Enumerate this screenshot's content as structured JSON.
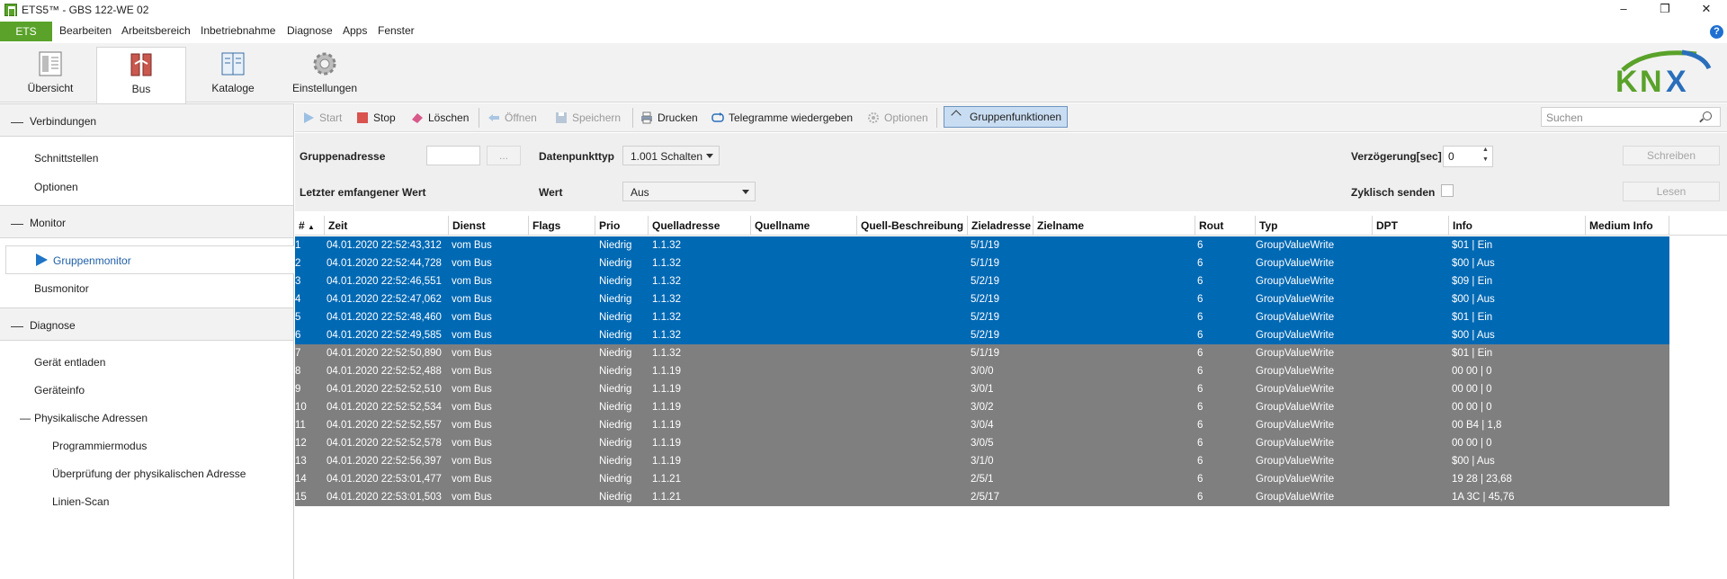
{
  "window": {
    "title": "ETS5™ - GBS 122-WE 02"
  },
  "menu": {
    "ets_label": "ETS",
    "items": [
      "Bearbeiten",
      "Arbeitsbereich",
      "Inbetriebnahme",
      "Diagnose",
      "Apps",
      "Fenster"
    ]
  },
  "ribbon": {
    "tabs": [
      "Übersicht",
      "Bus",
      "Kataloge",
      "Einstellungen"
    ]
  },
  "logo": {
    "text": "KNX"
  },
  "sidebar": {
    "sections": [
      {
        "label": "Verbindungen",
        "items": [
          "Schnittstellen",
          "Optionen"
        ]
      },
      {
        "label": "Monitor",
        "items": [
          "Gruppenmonitor",
          "Busmonitor"
        ]
      },
      {
        "label": "Diagnose",
        "items": [
          "Gerät entladen",
          "Geräteinfo",
          "Physikalische Adressen",
          "Programmiermodus",
          "Überprüfung der physikalischen Adresse",
          "Linien-Scan"
        ]
      }
    ]
  },
  "toolbar": {
    "start": "Start",
    "stop": "Stop",
    "loeschen": "Löschen",
    "oeffnen": "Öffnen",
    "speichern": "Speichern",
    "drucken": "Drucken",
    "telegramme": "Telegramme wiedergeben",
    "optionen": "Optionen",
    "gruppenfunktionen": "Gruppenfunktionen",
    "search_placeholder": "Suchen"
  },
  "filter": {
    "gruppenadresse_label": "Gruppenadresse",
    "gruppenadresse_btn": "...",
    "datenpunkttyp_label": "Datenpunkttyp",
    "datenpunkttyp_value": "1.001 Schalten",
    "letzter_label": "Letzter emfangener Wert",
    "wert_label": "Wert",
    "wert_value": "Aus",
    "verzoegerung_label": "Verzögerung[sec]",
    "verzoegerung_value": "0",
    "zyklisch_label": "Zyklisch senden",
    "schreiben": "Schreiben",
    "lesen": "Lesen"
  },
  "table": {
    "columns": [
      "#",
      "Zeit",
      "Dienst",
      "Flags",
      "Prio",
      "Quelladresse",
      "Quellname",
      "Quell-Beschreibung",
      "Zieladresse",
      "Zielname",
      "Rout",
      "Typ",
      "DPT",
      "Info",
      "Medium Info"
    ],
    "rows": [
      {
        "n": "1",
        "zeit": "04.01.2020 22:52:43,312",
        "dienst": "vom Bus",
        "prio": "Niedrig",
        "quelle": "1.1.32",
        "ziel": "5/1/19",
        "rout": "6",
        "typ": "GroupValueWrite",
        "info": "$01 | Ein",
        "selected": true
      },
      {
        "n": "2",
        "zeit": "04.01.2020 22:52:44,728",
        "dienst": "vom Bus",
        "prio": "Niedrig",
        "quelle": "1.1.32",
        "ziel": "5/1/19",
        "rout": "6",
        "typ": "GroupValueWrite",
        "info": "$00 | Aus",
        "selected": true
      },
      {
        "n": "3",
        "zeit": "04.01.2020 22:52:46,551",
        "dienst": "vom Bus",
        "prio": "Niedrig",
        "quelle": "1.1.32",
        "ziel": "5/2/19",
        "rout": "6",
        "typ": "GroupValueWrite",
        "info": "$09 | Ein",
        "selected": true
      },
      {
        "n": "4",
        "zeit": "04.01.2020 22:52:47,062",
        "dienst": "vom Bus",
        "prio": "Niedrig",
        "quelle": "1.1.32",
        "ziel": "5/2/19",
        "rout": "6",
        "typ": "GroupValueWrite",
        "info": "$00 | Aus",
        "selected": true
      },
      {
        "n": "5",
        "zeit": "04.01.2020 22:52:48,460",
        "dienst": "vom Bus",
        "prio": "Niedrig",
        "quelle": "1.1.32",
        "ziel": "5/2/19",
        "rout": "6",
        "typ": "GroupValueWrite",
        "info": "$01 | Ein",
        "selected": true
      },
      {
        "n": "6",
        "zeit": "04.01.2020 22:52:49,585",
        "dienst": "vom Bus",
        "prio": "Niedrig",
        "quelle": "1.1.32",
        "ziel": "5/2/19",
        "rout": "6",
        "typ": "GroupValueWrite",
        "info": "$00 | Aus",
        "selected": true
      },
      {
        "n": "7",
        "zeit": "04.01.2020 22:52:50,890",
        "dienst": "vom Bus",
        "prio": "Niedrig",
        "quelle": "1.1.32",
        "ziel": "5/1/19",
        "rout": "6",
        "typ": "GroupValueWrite",
        "info": "$01 | Ein",
        "selected": false
      },
      {
        "n": "8",
        "zeit": "04.01.2020 22:52:52,488",
        "dienst": "vom Bus",
        "prio": "Niedrig",
        "quelle": "1.1.19",
        "ziel": "3/0/0",
        "rout": "6",
        "typ": "GroupValueWrite",
        "info": "00 00 | 0",
        "selected": false
      },
      {
        "n": "9",
        "zeit": "04.01.2020 22:52:52,510",
        "dienst": "vom Bus",
        "prio": "Niedrig",
        "quelle": "1.1.19",
        "ziel": "3/0/1",
        "rout": "6",
        "typ": "GroupValueWrite",
        "info": "00 00 | 0",
        "selected": false
      },
      {
        "n": "10",
        "zeit": "04.01.2020 22:52:52,534",
        "dienst": "vom Bus",
        "prio": "Niedrig",
        "quelle": "1.1.19",
        "ziel": "3/0/2",
        "rout": "6",
        "typ": "GroupValueWrite",
        "info": "00 00 | 0",
        "selected": false
      },
      {
        "n": "11",
        "zeit": "04.01.2020 22:52:52,557",
        "dienst": "vom Bus",
        "prio": "Niedrig",
        "quelle": "1.1.19",
        "ziel": "3/0/4",
        "rout": "6",
        "typ": "GroupValueWrite",
        "info": "00 B4 | 1,8",
        "selected": false
      },
      {
        "n": "12",
        "zeit": "04.01.2020 22:52:52,578",
        "dienst": "vom Bus",
        "prio": "Niedrig",
        "quelle": "1.1.19",
        "ziel": "3/0/5",
        "rout": "6",
        "typ": "GroupValueWrite",
        "info": "00 00 | 0",
        "selected": false
      },
      {
        "n": "13",
        "zeit": "04.01.2020 22:52:56,397",
        "dienst": "vom Bus",
        "prio": "Niedrig",
        "quelle": "1.1.19",
        "ziel": "3/1/0",
        "rout": "6",
        "typ": "GroupValueWrite",
        "info": "$00 | Aus",
        "selected": false
      },
      {
        "n": "14",
        "zeit": "04.01.2020 22:53:01,477",
        "dienst": "vom Bus",
        "prio": "Niedrig",
        "quelle": "1.1.21",
        "ziel": "2/5/1",
        "rout": "6",
        "typ": "GroupValueWrite",
        "info": "19 28 | 23,68",
        "selected": false
      },
      {
        "n": "15",
        "zeit": "04.01.2020 22:53:01,503",
        "dienst": "vom Bus",
        "prio": "Niedrig",
        "quelle": "1.1.21",
        "ziel": "2/5/17",
        "rout": "6",
        "typ": "GroupValueWrite",
        "info": "1A 3C | 45,76",
        "selected": false
      }
    ]
  },
  "colors": {
    "accent": "#5aa22a",
    "selection": "#0069b4",
    "row_gray": "#7f7f7f",
    "knx_green": "#5aa22a",
    "knx_blue": "#2a6ebb"
  }
}
